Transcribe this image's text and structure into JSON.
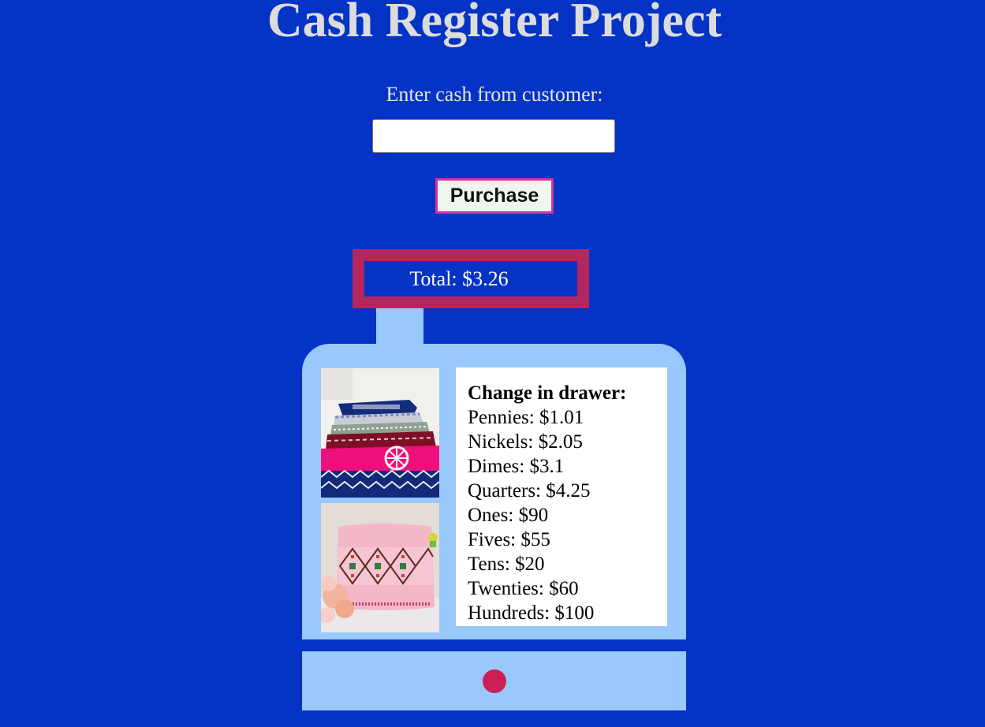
{
  "title": "Cash Register Project",
  "cash_label": "Enter cash from customer:",
  "cash_input": {
    "value": "",
    "placeholder": ""
  },
  "purchase_label": "Purchase",
  "total_text": "Total: $3.26",
  "drawer": {
    "heading": "Change in drawer:",
    "items": [
      "Pennies: $1.01",
      "Nickels: $2.05",
      "Dimes: $3.1",
      "Quarters: $4.25",
      "Ones: $90",
      "Fives: $55",
      "Tens: $20",
      "Twenties: $60",
      "Hundreds: $100"
    ]
  },
  "images": [
    {
      "icon": "folded-embroidered-fabrics-image"
    },
    {
      "icon": "embroidered-pillow-image"
    }
  ],
  "colors": {
    "background": "#0433c6",
    "title": "#dcdcdc",
    "total_border": "#b3275e",
    "register": "#99c9fc",
    "button_border": "#d1339a",
    "red_button": "#cc1f55"
  }
}
